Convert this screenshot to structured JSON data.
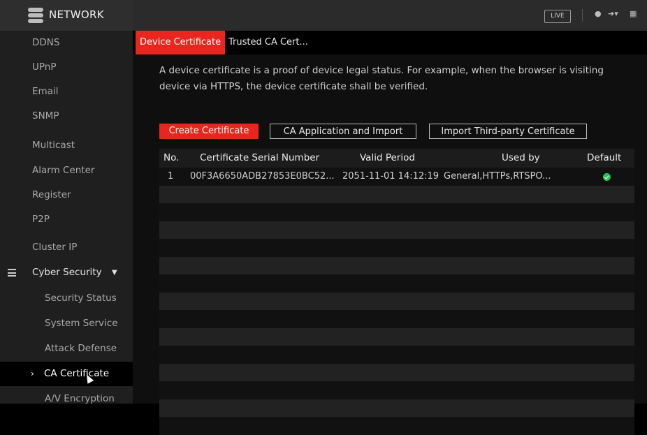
{
  "app": {
    "title": "NETWORK",
    "live_label": "LIVE"
  },
  "colors": {
    "accent": "#e8261d",
    "ok": "#2ec15a"
  },
  "topbar_icons": [
    "user-icon",
    "logout-icon",
    "qr-icon"
  ],
  "sidebar": {
    "items": [
      {
        "label": "DDNS"
      },
      {
        "label": "UPnP"
      },
      {
        "label": "Email"
      },
      {
        "label": "SNMP"
      },
      {
        "label": "Multicast"
      },
      {
        "label": "Alarm Center"
      },
      {
        "label": "Register"
      },
      {
        "label": "P2P"
      },
      {
        "label": "Cluster IP"
      },
      {
        "label": "Cyber Security"
      },
      {
        "label": "Security Status"
      },
      {
        "label": "System Service"
      },
      {
        "label": "Attack Defense"
      },
      {
        "label": "CA Certificate"
      },
      {
        "label": "A/V Encryption"
      }
    ]
  },
  "tabs": [
    {
      "label": "Device Certificate"
    },
    {
      "label": "Trusted CA Cert..."
    }
  ],
  "description": "A device certificate is a proof of device legal status. For example, when the browser is visiting device via HTTPS, the device certificate shall be verified.",
  "buttons": {
    "create": "Create Certificate",
    "ca_import": "CA Application and Import",
    "third_party": "Import Third-party Certificate"
  },
  "table": {
    "headers": [
      "No.",
      "Certificate Serial Number",
      "Valid Period",
      "Used by",
      "Default"
    ],
    "rows": [
      {
        "no": "1",
        "serial": "00F3A6650ADB27853E0BC52...",
        "valid": "2051-11-01 14:12:19",
        "used_by": "General,HTTPs,RTSPO...",
        "default": true
      }
    ]
  }
}
